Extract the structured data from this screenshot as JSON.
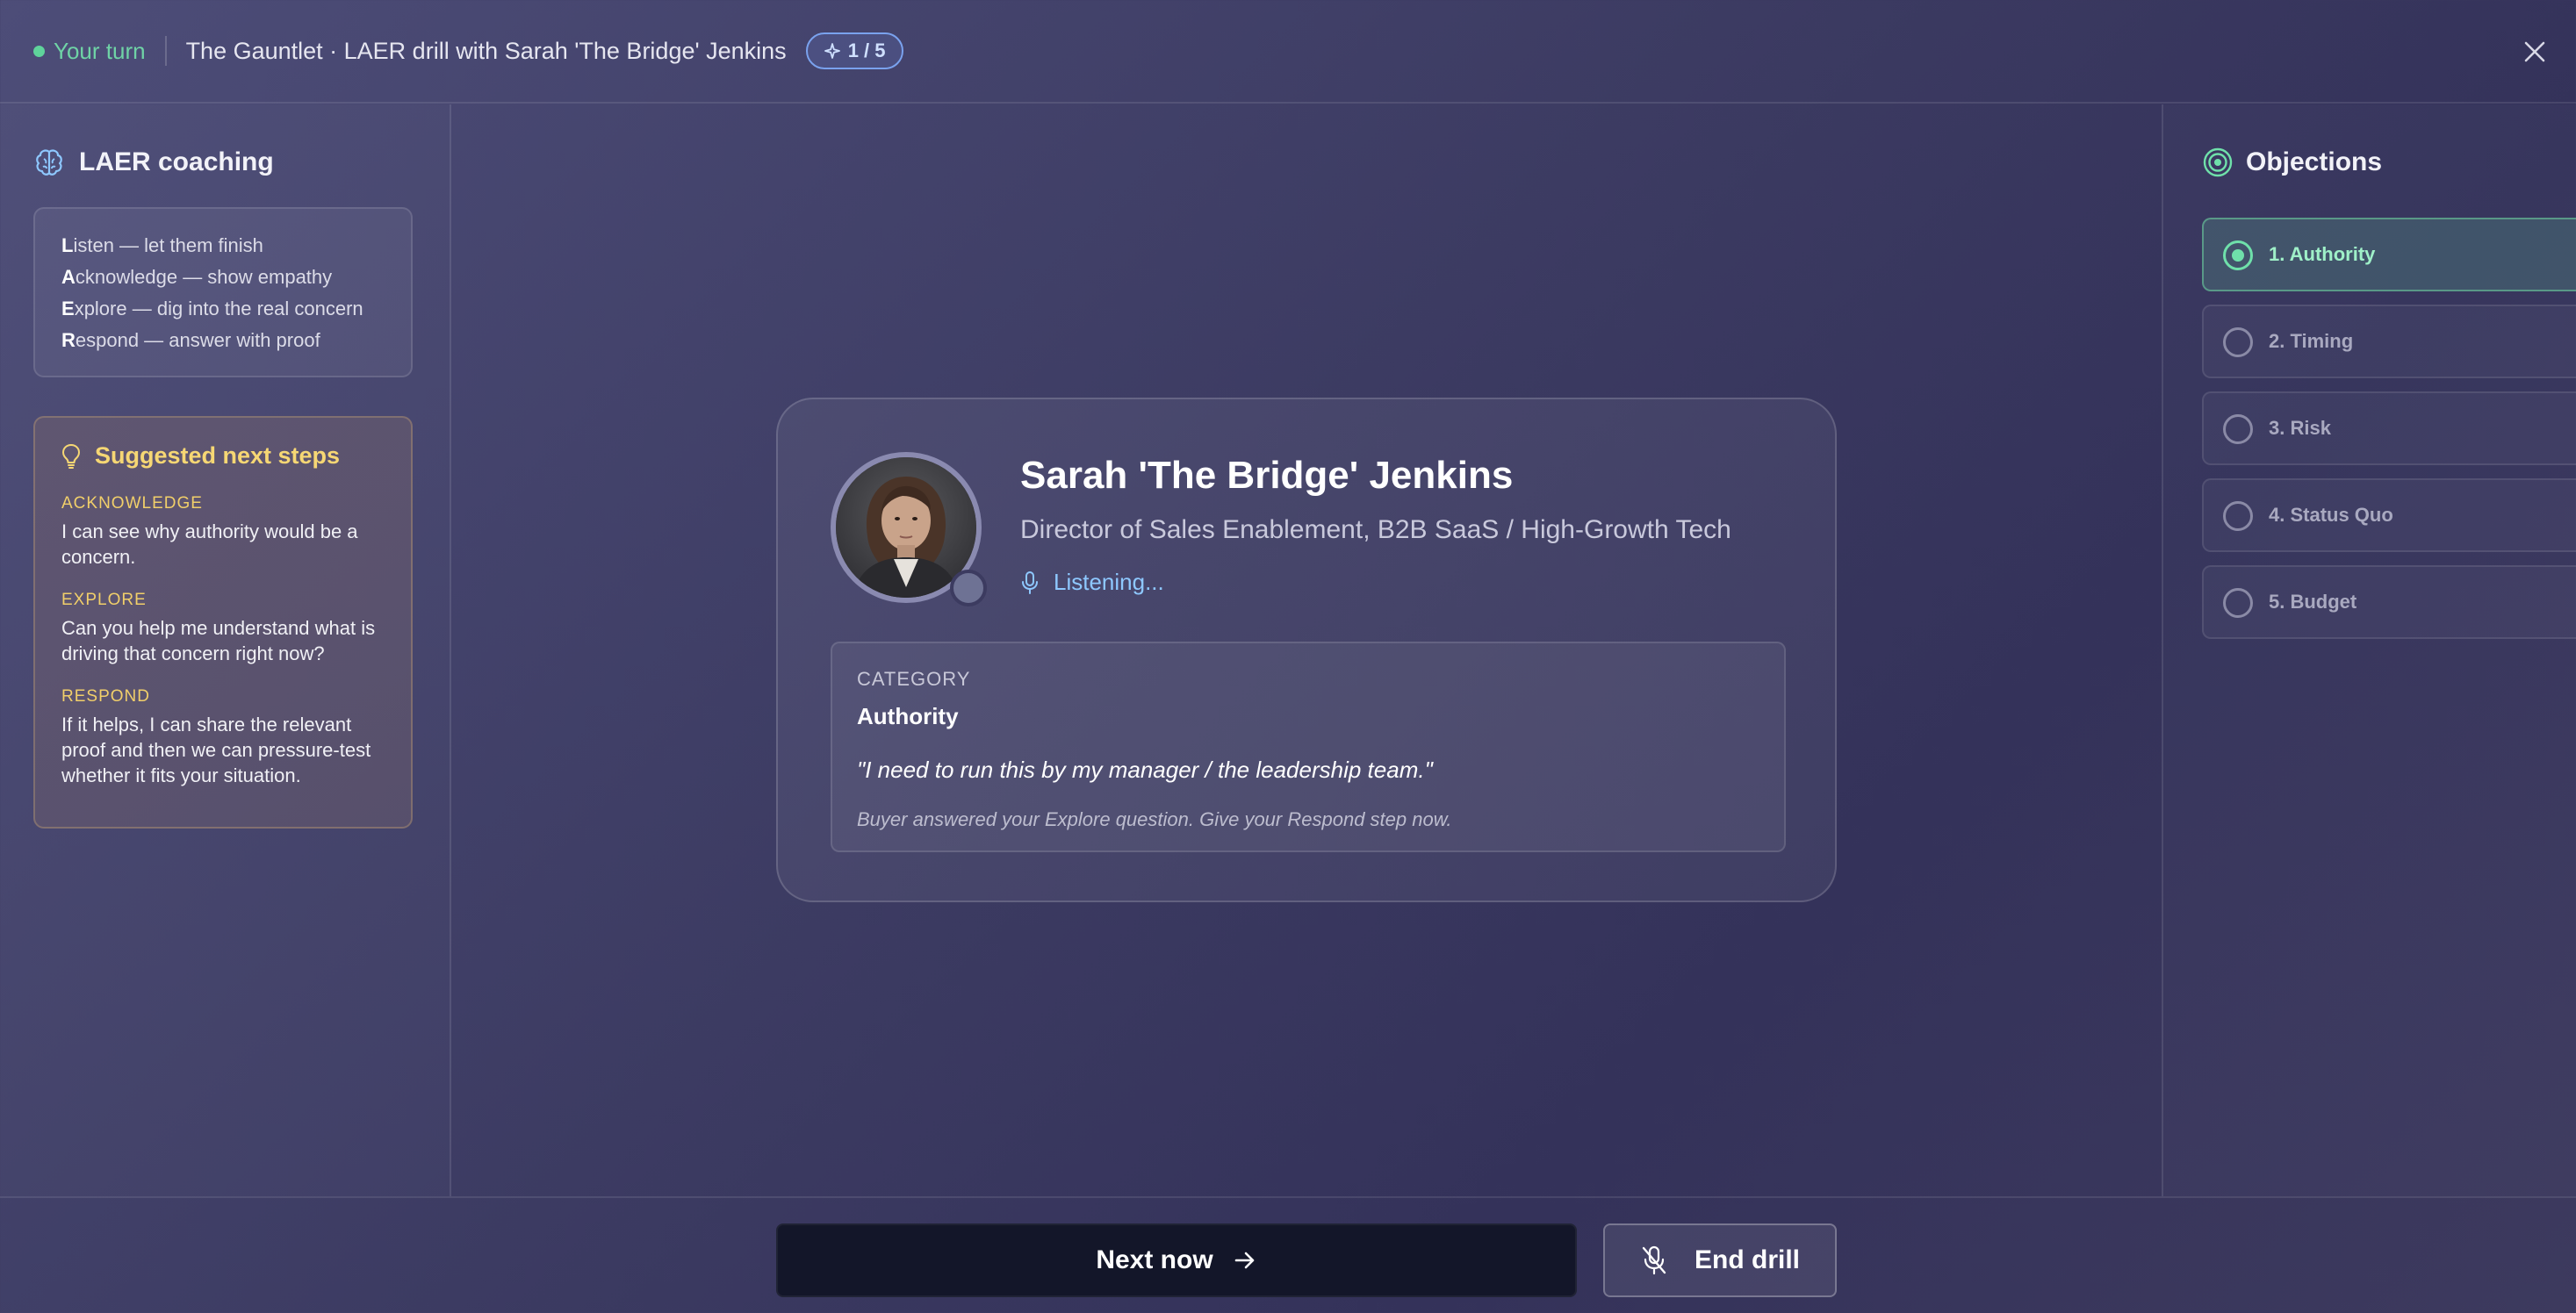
{
  "header": {
    "status": "Your turn",
    "title": "The Gauntlet · LAER drill with Sarah 'The Bridge' Jenkins",
    "badge": "1 / 5"
  },
  "left_panel": {
    "laer_title": "LAER coaching",
    "laer_lines": [
      {
        "letter": "L",
        "rest": "isten — let them finish"
      },
      {
        "letter": "A",
        "rest": "cknowledge — show empathy"
      },
      {
        "letter": "E",
        "rest": "xplore — dig into the real concern"
      },
      {
        "letter": "R",
        "rest": "espond — answer with proof"
      }
    ],
    "suggestions_title": "Suggested next steps",
    "suggestions": [
      {
        "label": "ACKNOWLEDGE",
        "text": "I can see why authority would be a concern."
      },
      {
        "label": "EXPLORE",
        "text": "Can you help me understand what is driving that concern right now?"
      },
      {
        "label": "RESPOND",
        "text": "If it helps, I can share the relevant proof and then we can pressure-test whether it fits your situation."
      }
    ]
  },
  "persona": {
    "name": "Sarah 'The Bridge' Jenkins",
    "role": "Director of Sales Enablement, B2B SaaS / High-Growth Tech",
    "status": "Listening...",
    "category_label": "CATEGORY",
    "category": "Authority",
    "quote": "\"I need to run this by my manager / the leadership team.\"",
    "hint": "Buyer answered your Explore question. Give your Respond step now."
  },
  "right_panel": {
    "title": "Objections",
    "items": [
      {
        "label": "1. Authority",
        "active": true
      },
      {
        "label": "2. Timing",
        "active": false
      },
      {
        "label": "3. Risk",
        "active": false
      },
      {
        "label": "4. Status Quo",
        "active": false
      },
      {
        "label": "5. Budget",
        "active": false
      }
    ]
  },
  "footer": {
    "next_label": "Next now",
    "end_label": "End drill"
  },
  "colors": {
    "accent_green": "#6fe0aa",
    "accent_yellow": "#f1cf6a",
    "accent_blue": "#8ec8ff"
  }
}
